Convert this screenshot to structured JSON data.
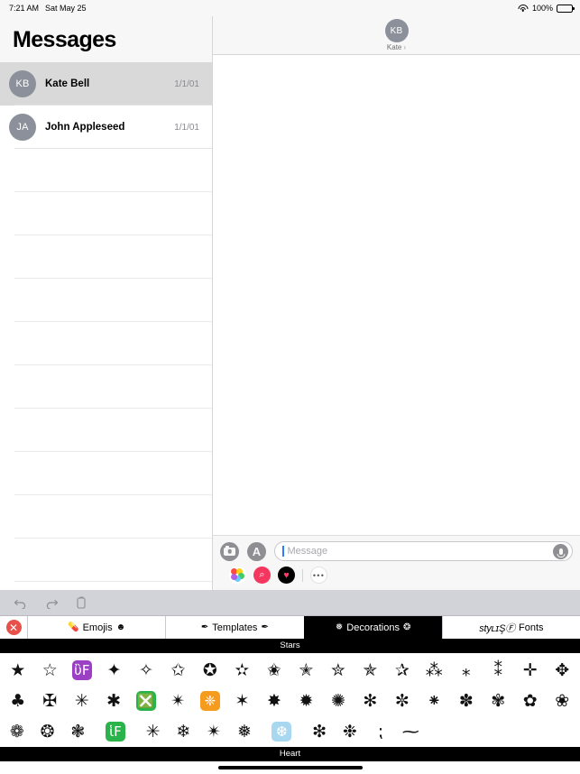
{
  "status_bar": {
    "time": "7:21 AM",
    "date": "Sat May 25",
    "wifi_icon": "wifi-icon",
    "battery_percent": "100%",
    "battery_icon": "battery-full-icon"
  },
  "sidebar": {
    "title": "Messages",
    "conversations": [
      {
        "initials": "KB",
        "name": "Kate Bell",
        "date": "1/1/01",
        "selected": true
      },
      {
        "initials": "JA",
        "name": "John Appleseed",
        "date": "1/1/01",
        "selected": false
      }
    ],
    "empty_row_count": 14
  },
  "conversation": {
    "header": {
      "initials": "KB",
      "name": "Kate",
      "chevron": "›",
      "chevron_icon": "chevron-right-icon"
    }
  },
  "input_bar": {
    "camera_icon": "camera-icon",
    "appstore_icon": "app-store-icon",
    "appstore_glyph": "A",
    "message_placeholder": "Message",
    "message_value": "",
    "mic_icon": "microphone-icon",
    "apps": [
      {
        "name": "photos-app-icon",
        "glyph": ""
      },
      {
        "name": "music-app-icon",
        "glyph": "⌕"
      },
      {
        "name": "fitness-app-icon",
        "glyph": "♥"
      }
    ],
    "more_label": "•••"
  },
  "panel": {
    "toolbar": [
      {
        "name": "undo-button",
        "icon": "undo-arrow-icon"
      },
      {
        "name": "redo-button",
        "icon": "redo-arrow-icon"
      },
      {
        "name": "duplicate-button",
        "icon": "copy-icon"
      }
    ],
    "close_label": "✕",
    "tabs": [
      {
        "label": "Emojis",
        "left_icon": "ὈA",
        "right_icon": "☻",
        "active": false
      },
      {
        "label": "Templates",
        "left_icon": "✎",
        "right_icon": "✎",
        "active": false
      },
      {
        "label": "Decorations",
        "left_icon": "❅",
        "right_icon": "❂",
        "active": true
      },
      {
        "label": "Fonts",
        "prefix": "stуʟɪŞⒻ",
        "active": false
      }
    ],
    "sections": [
      {
        "title": "Stars",
        "rows": [
          [
            "★",
            "☆",
            "ὒF",
            "✦",
            "✧",
            "✩",
            "✪",
            "✫",
            "✬",
            "✭",
            "✮",
            "✯",
            "✰",
            "⁂",
            "⁎",
            "⁑",
            "✛",
            "✥"
          ],
          [
            "♣",
            "✠",
            "✳",
            "✱",
            "❎",
            "✴",
            "❈",
            "✶",
            "✸",
            "✹",
            "✺",
            "✻",
            "✼",
            "⁕",
            "✽",
            "✾",
            "✿",
            "❀"
          ],
          [
            "❁",
            "❂",
            "❃",
            "ἱF",
            "✳",
            "❄",
            "✴",
            "❅",
            "❆",
            "❇",
            "❉",
            "⁏",
            "⁓"
          ]
        ]
      },
      {
        "title": "Heart"
      }
    ]
  },
  "colors": {
    "accent_red": "#e8504a",
    "active_tab_bg": "#000000",
    "panel_bg": "#d1d3d9",
    "selected_row": "#d9d9d9",
    "avatar_gray": "#8b909b"
  }
}
